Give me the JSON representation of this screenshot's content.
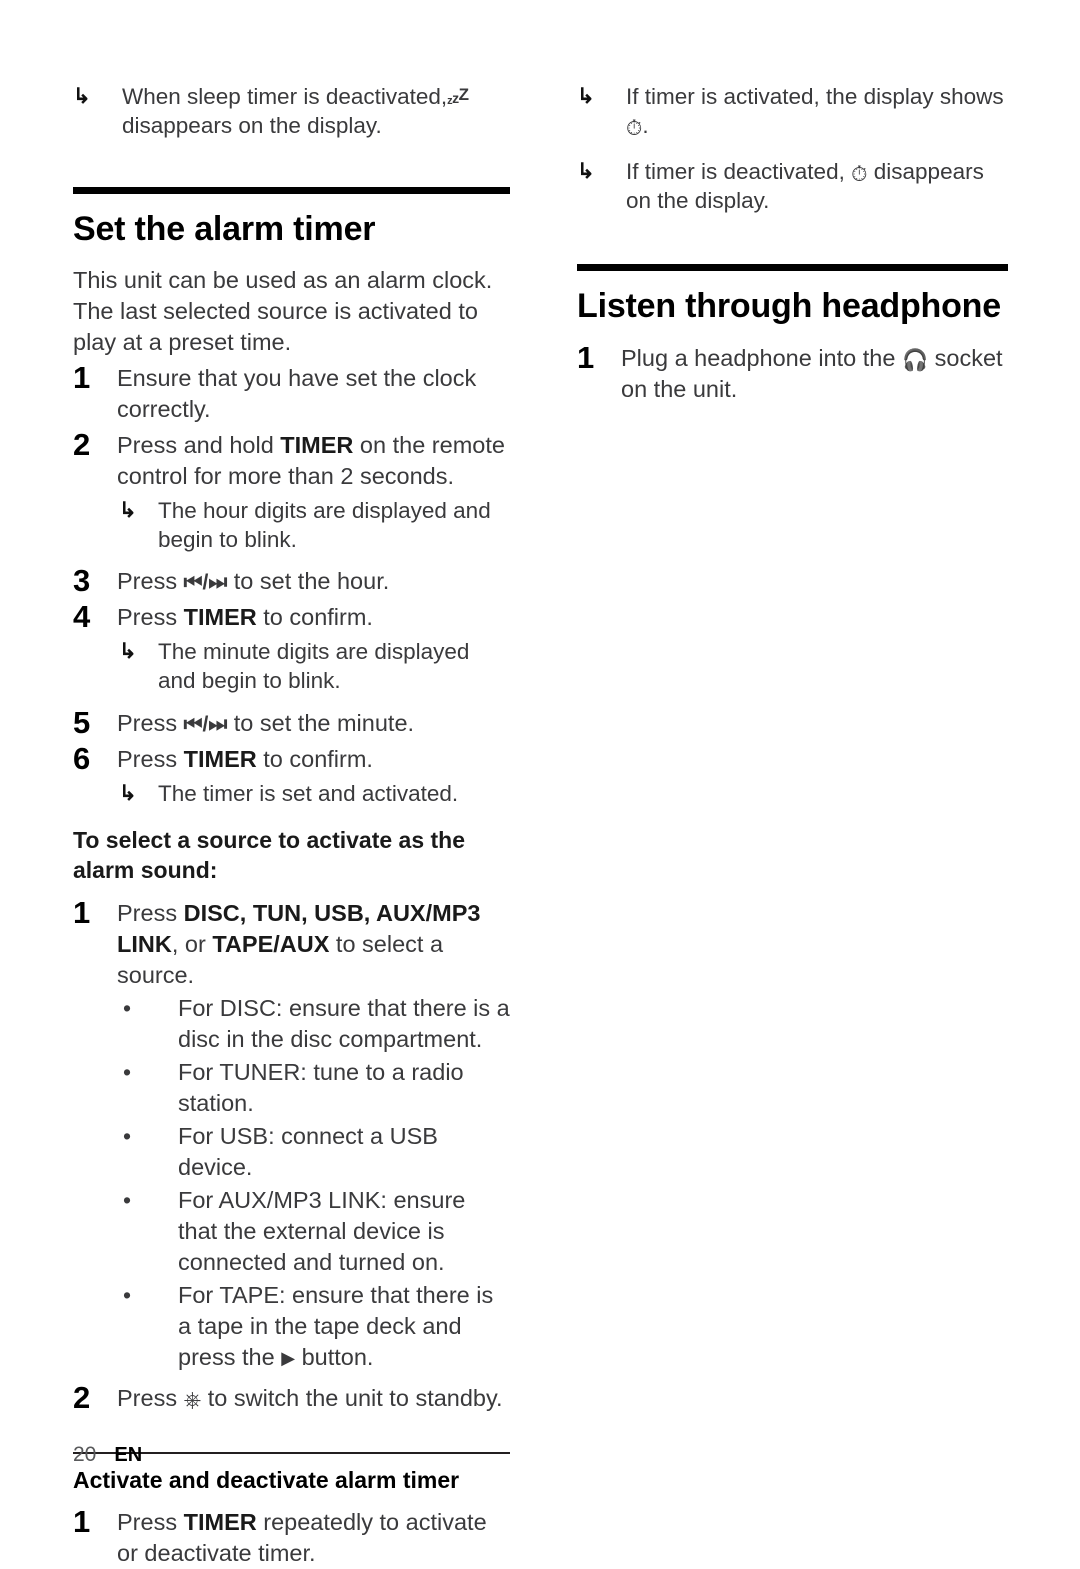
{
  "page": {
    "number": "20",
    "language": "EN"
  },
  "icons": {
    "sleep": "zZZ",
    "alarm": "alarm-clock-glyph",
    "headphone": "headphone-glyph",
    "power": "power-standby-glyph",
    "play": "play-glyph",
    "prev_next": "prev-next-track-glyph",
    "result_arrow": "result-arrow-glyph",
    "bullet_dot": "bullet-dot-glyph"
  },
  "left_column": {
    "top_note": {
      "text_before": "When sleep timer is deactivated,",
      "text_after": "disappears on the display."
    },
    "section": {
      "title": "Set the alarm timer",
      "intro": "This unit can be used as an alarm clock. The last selected source is activated to play at a preset time.",
      "steps": [
        {
          "num": "1",
          "text": "Ensure that you have set the clock correctly."
        },
        {
          "num": "2",
          "text_before": "Press and hold ",
          "bold": "TIMER",
          "text_after": " on the remote control for more than 2 seconds.",
          "note": "The hour digits are displayed and begin to blink."
        },
        {
          "num": "3",
          "text_before": "Press ",
          "glyph": "prev_next",
          "text_after": " to set the hour."
        },
        {
          "num": "4",
          "text_before": "Press ",
          "bold": "TIMER",
          "text_after": " to confirm.",
          "note": "The minute digits are displayed and begin to blink."
        },
        {
          "num": "5",
          "text_before": "Press ",
          "glyph": "prev_next",
          "text_after": " to set the minute."
        },
        {
          "num": "6",
          "text_before": "Press ",
          "bold": "TIMER",
          "text_after": " to confirm.",
          "note": "The timer is set and activated."
        }
      ],
      "source_lead": "To select a source to activate as the alarm sound:",
      "source_steps": [
        {
          "num": "1",
          "text_before": "Press ",
          "bold_list": "DISC, TUN, USB, AUX/MP3 LINK",
          "text_middle": ", or ",
          "bold_last": "TAPE/AUX",
          "text_after": " to select a source.",
          "bullets": [
            "For DISC: ensure that there is a disc in the disc compartment.",
            "For TUNER: tune to a radio station.",
            "For USB: connect a USB device.",
            "For AUX/MP3 LINK: ensure that the external device is connected and turned on."
          ],
          "bullet_tape_before": "For TAPE: ensure that there is a tape in the tape deck and press the ",
          "bullet_tape_after": " button."
        },
        {
          "num": "2",
          "text_before": "Press ",
          "text_after": " to switch the unit to standby."
        }
      ]
    },
    "subsection": {
      "title": "Activate and deactivate alarm timer",
      "steps": [
        {
          "num": "1",
          "text_before": "Press ",
          "bold": "TIMER",
          "text_after": " repeatedly to activate or deactivate timer."
        }
      ]
    }
  },
  "right_column": {
    "top_notes": [
      {
        "text_before": "If timer is activated, the display shows",
        "text_after": "."
      },
      {
        "text_before": "If timer is deactivated,",
        "text_after": "disappears on the display."
      }
    ],
    "section": {
      "title": "Listen through headphone",
      "steps": [
        {
          "num": "1",
          "text_before": "Plug a headphone into the ",
          "text_after": " socket on the unit."
        }
      ]
    }
  }
}
